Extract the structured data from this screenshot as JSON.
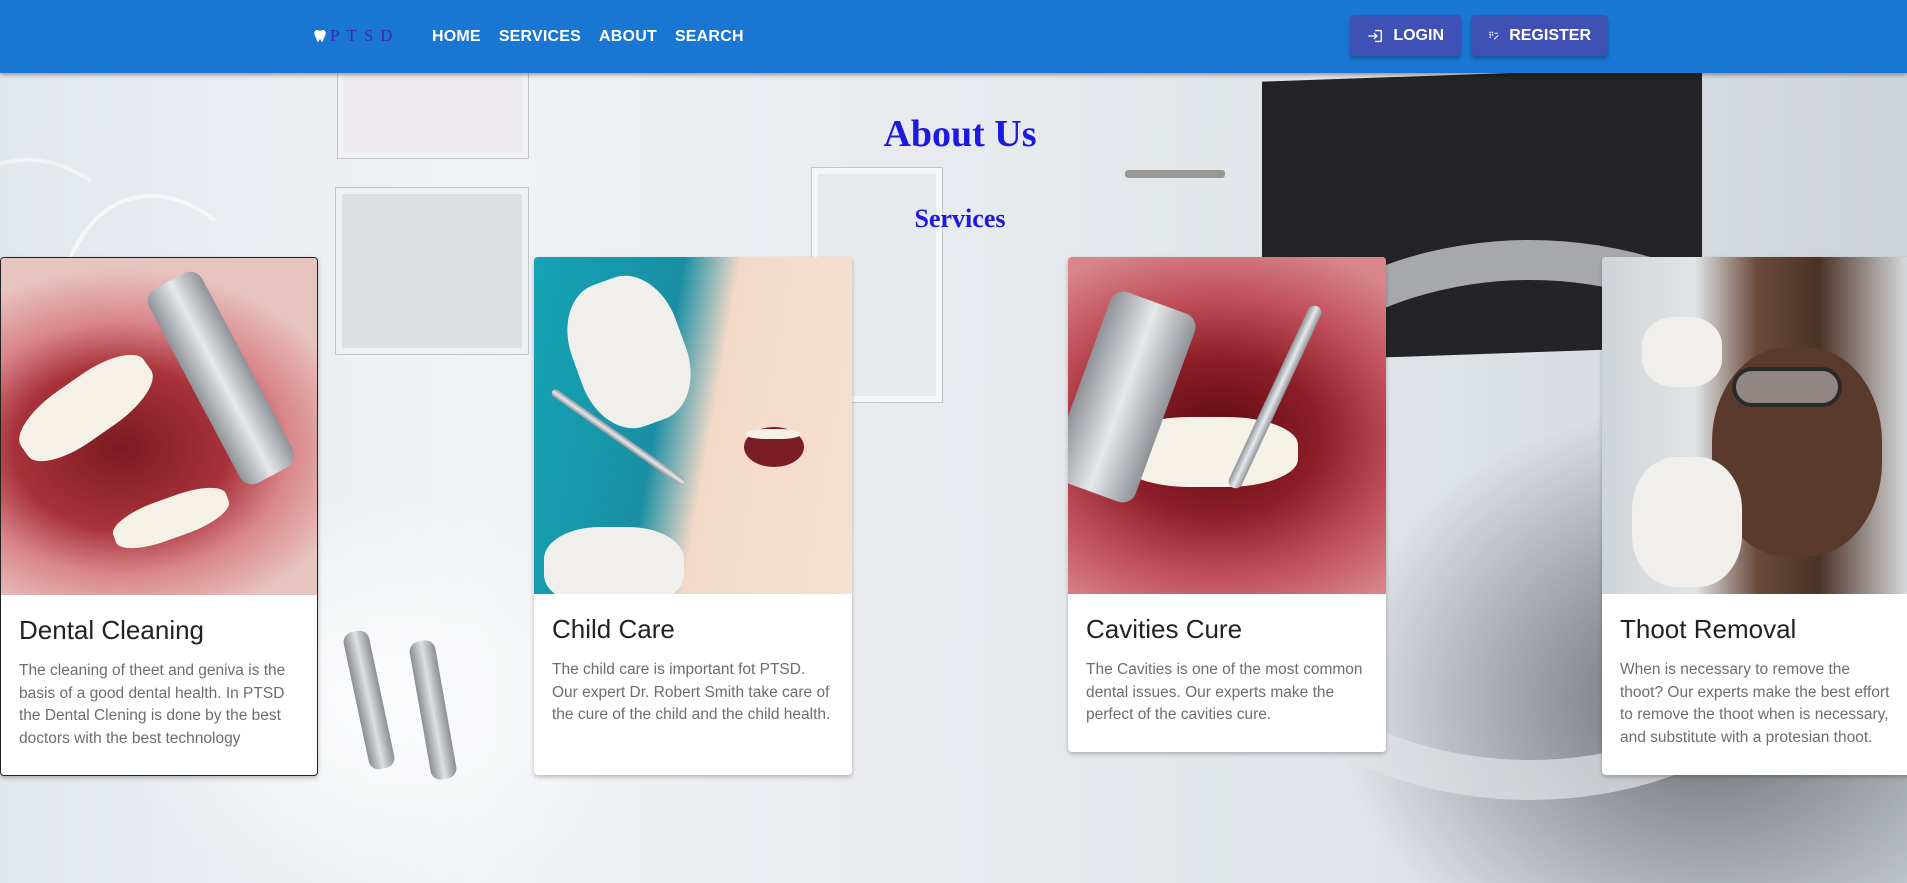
{
  "brand": {
    "name": "PTSD",
    "icon": "tooth-icon"
  },
  "nav": {
    "links": [
      {
        "label": "HOME"
      },
      {
        "label": "SERVICES"
      },
      {
        "label": "ABOUT"
      },
      {
        "label": "SEARCH"
      }
    ],
    "login": {
      "label": "LOGIN",
      "icon": "login-icon"
    },
    "register": {
      "label": "REGISTER",
      "icon": "register-icon"
    }
  },
  "headings": {
    "about": "About Us",
    "services": "Services"
  },
  "cards": [
    {
      "title": "Dental Cleaning",
      "description": "The cleaning of theet and geniva is the basis of a good dental health. In PTSD the Dental Clening is done by the best doctors with the best technology"
    },
    {
      "title": "Child Care",
      "description": "The child care is important fot PTSD. Our expert Dr. Robert Smith take care of the cure of the child and the child health."
    },
    {
      "title": "Cavities Cure",
      "description": "The Cavities is one of the most common dental issues. Our experts make the perfect of the cavities cure."
    },
    {
      "title": "Thoot Removal",
      "description": "When is necessary to remove the thoot? Our experts make the best effort to remove the thoot when is necessary, and substitute with a protesian thoot."
    }
  ],
  "colors": {
    "navbar": "#1976d2",
    "button": "#3f51b5",
    "heading": "#1d1ae0"
  }
}
